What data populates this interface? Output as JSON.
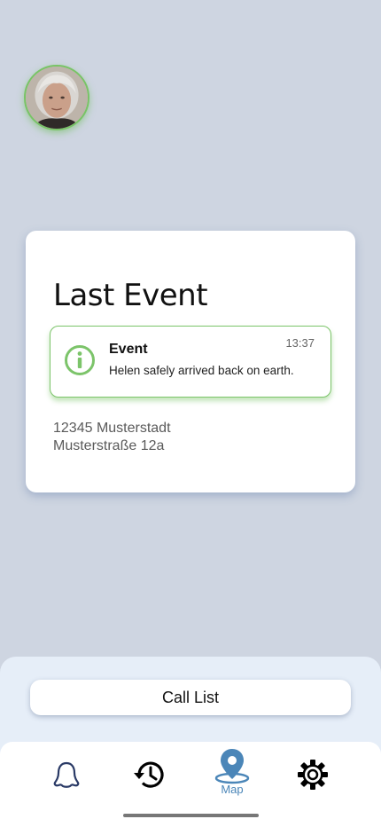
{
  "profile": {
    "avatar_icon": "elderly-woman-portrait",
    "ring_color": "#78c466"
  },
  "card": {
    "title": "Last Event",
    "event": {
      "icon": "info-icon",
      "title": "Event",
      "time": "13:37",
      "message": "Helen safely arrived back on earth."
    },
    "address": {
      "line1": "12345 Musterstadt",
      "line2": "Musterstraße 12a"
    }
  },
  "call_list": {
    "label": "Call List"
  },
  "nav": {
    "items": [
      {
        "icon": "bell-icon",
        "label": ""
      },
      {
        "icon": "history-icon",
        "label": ""
      },
      {
        "icon": "map-pin-icon",
        "label": "Map",
        "active": true
      },
      {
        "icon": "gear-icon",
        "label": ""
      }
    ],
    "active_color": "#4b86b8"
  },
  "colors": {
    "accent_green": "#7cc46a",
    "background": "#ced5e1"
  }
}
